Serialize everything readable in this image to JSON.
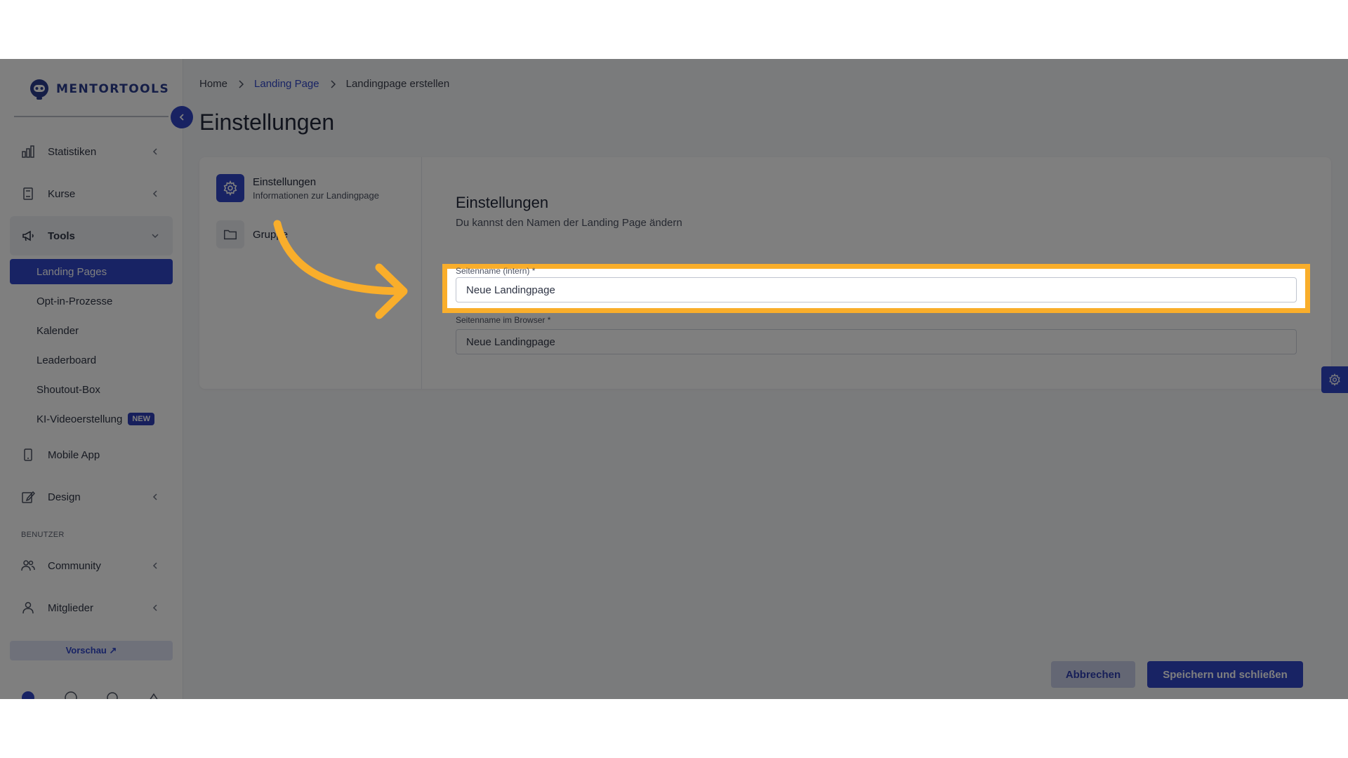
{
  "brand": {
    "name": "MENTORTOOLS"
  },
  "sidebar": {
    "items": [
      {
        "label": "Statistiken",
        "icon": "bar-chart-icon"
      },
      {
        "label": "Kurse",
        "icon": "book-icon"
      },
      {
        "label": "Tools",
        "icon": "megaphone-icon"
      }
    ],
    "tools_sub": [
      {
        "label": "Landing Pages"
      },
      {
        "label": "Opt-in-Prozesse"
      },
      {
        "label": "Kalender"
      },
      {
        "label": "Leaderboard"
      },
      {
        "label": "Shoutout-Box"
      },
      {
        "label": "KI-Videoerstellung",
        "badge": "NEW"
      }
    ],
    "mobile_app": {
      "label": "Mobile App",
      "icon": "phone-icon"
    },
    "design": {
      "label": "Design",
      "icon": "pencil-icon"
    },
    "section_benutzer": "BENUTZER",
    "community": {
      "label": "Community",
      "icon": "users-icon"
    },
    "mitglieder": {
      "label": "Mitglieder",
      "icon": "user-icon"
    },
    "preview_label": "Vorschau ↗"
  },
  "breadcrumb": {
    "home": "Home",
    "landing": "Landing Page",
    "current": "Landingpage erstellen"
  },
  "page": {
    "title": "Einstellungen"
  },
  "steps": [
    {
      "title": "Einstellungen",
      "subtitle": "Informationen zur Landingpage",
      "icon": "gear-icon"
    },
    {
      "title": "Gruppe",
      "icon": "folder-icon"
    }
  ],
  "form": {
    "title": "Einstellungen",
    "subtitle": "Du kannst den Namen der Landing Page ändern",
    "field1_label": "Seitenname (intern) *",
    "field1_value": "Neue Landingpage",
    "field2_label": "Seitenname im Browser *",
    "field2_value": "Neue Landingpage"
  },
  "actions": {
    "cancel": "Abbrechen",
    "save": "Speichern und schließen"
  },
  "colors": {
    "primary": "#3046c8",
    "highlight": "#f9ae2b"
  }
}
